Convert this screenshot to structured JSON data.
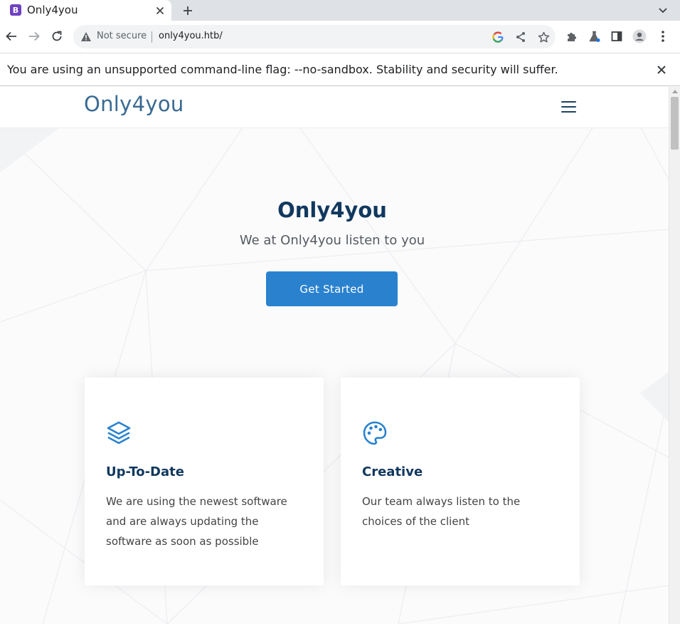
{
  "browser": {
    "tab": {
      "title": "Only4you",
      "favicon_letter": "B",
      "favicon_color": "#6f42c1"
    },
    "omnibox": {
      "security_label": "Not secure",
      "url": "only4you.htb/"
    },
    "infobar": {
      "message": "You are using an unsupported command-line flag: --no-sandbox. Stability and security will suffer."
    }
  },
  "site": {
    "logo": "Only4you",
    "hero": {
      "title": "Only4you",
      "subtitle": "We at Only4you listen to you",
      "cta_label": "Get Started"
    },
    "cards": [
      {
        "icon": "layers-icon",
        "title": "Up-To-Date",
        "text": "We are using the newest software and are always updating the software as soon as possible"
      },
      {
        "icon": "palette-icon",
        "title": "Creative",
        "text": "Our team always listen to the choices of the client"
      }
    ]
  },
  "colors": {
    "accent": "#2a82cf",
    "heading": "#11385e",
    "logo": "#3a6a92"
  }
}
